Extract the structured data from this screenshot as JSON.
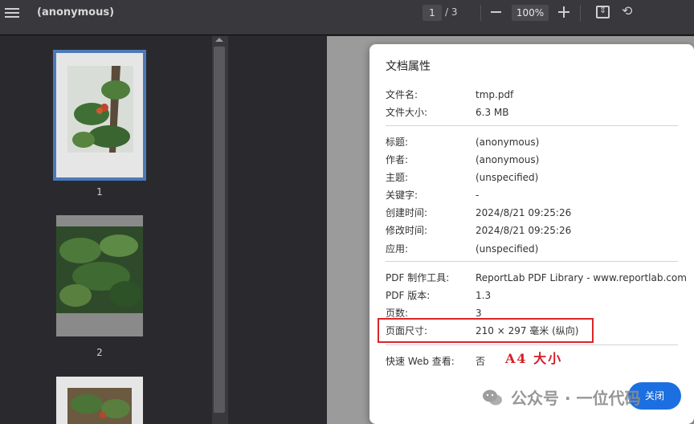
{
  "toolbar": {
    "doc_title": "(anonymous)",
    "page_current": "1",
    "page_total": "/ 3",
    "zoom": "100%"
  },
  "sidebar": {
    "thumbnails": [
      {
        "label": "1",
        "selected": true
      },
      {
        "label": "2",
        "selected": false
      }
    ]
  },
  "dialog": {
    "title": "文档属性",
    "file": [
      {
        "key": "文件名:",
        "value": "tmp.pdf"
      },
      {
        "key": "文件大小:",
        "value": "6.3 MB"
      }
    ],
    "meta": [
      {
        "key": "标题:",
        "value": "(anonymous)"
      },
      {
        "key": "作者:",
        "value": "(anonymous)"
      },
      {
        "key": "主题:",
        "value": "(unspecified)"
      },
      {
        "key": "关键字:",
        "value": "-"
      },
      {
        "key": "创建时间:",
        "value": "2024/8/21 09:25:26"
      },
      {
        "key": "修改时间:",
        "value": "2024/8/21 09:25:26"
      },
      {
        "key": "应用:",
        "value": "(unspecified)"
      }
    ],
    "pdf": [
      {
        "key": "PDF 制作工具:",
        "value": "ReportLab PDF Library - www.reportlab.com"
      },
      {
        "key": "PDF 版本:",
        "value": "1.3"
      },
      {
        "key": "页数:",
        "value": "3"
      },
      {
        "key": "页面尺寸:",
        "value": "210 × 297 毫米 (纵向)"
      }
    ],
    "web": {
      "key": "快速 Web 查看:",
      "value": "否"
    },
    "annotation": "A4 大小",
    "close_label": "关闭"
  },
  "watermark": "公众号 · 一位代码"
}
